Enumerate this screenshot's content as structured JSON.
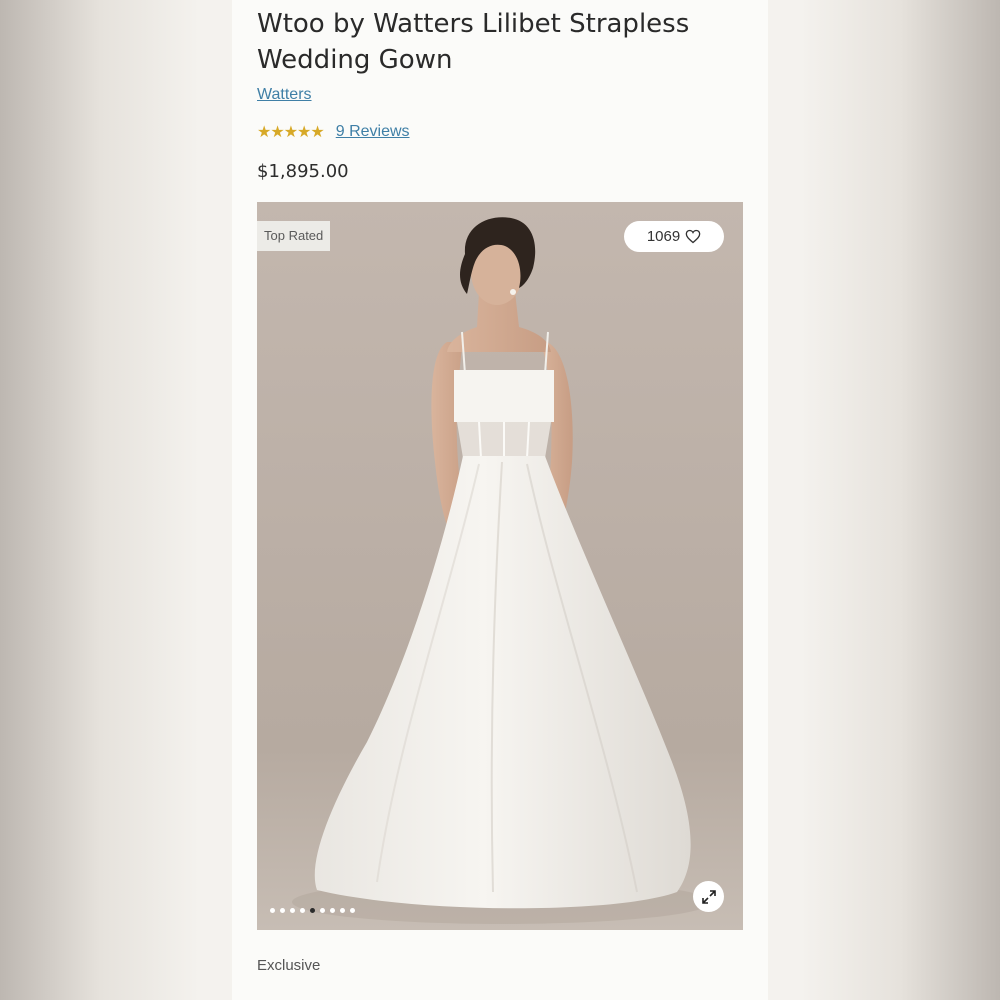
{
  "product": {
    "title": "Wtoo by Watters Lilibet Strapless Wedding Gown",
    "brand": "Watters",
    "stars": "★★★★★",
    "rating": 5,
    "reviews_label": "9 Reviews",
    "price": "$1,895.00"
  },
  "image": {
    "badge": "Top Rated",
    "likes": "1069",
    "carousel_total": 9,
    "carousel_active": 5
  },
  "footer": {
    "tag": "Exclusive"
  },
  "colors": {
    "link": "#3f7fa6",
    "star": "#d7a928",
    "photo_background": "#bcb0a7"
  }
}
